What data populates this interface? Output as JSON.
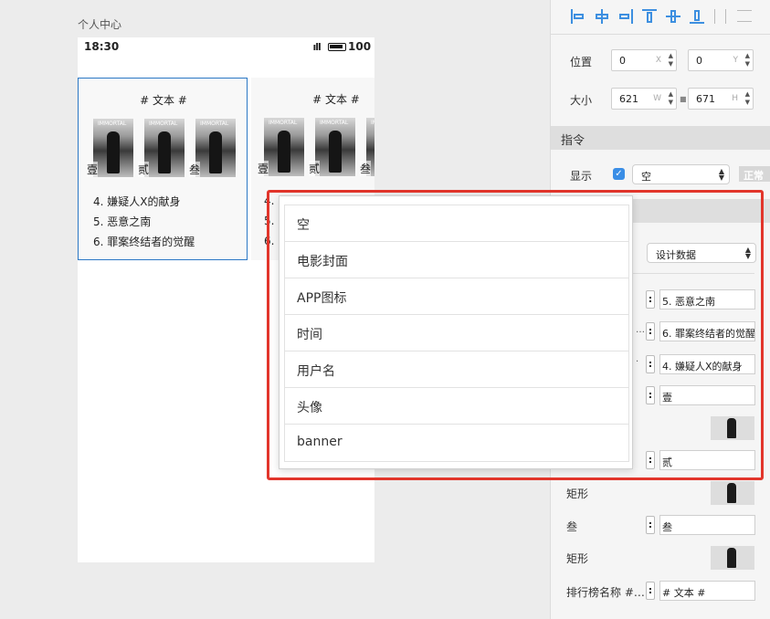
{
  "canvas": {
    "artboard_title": "个人中心",
    "status_bar": {
      "time": "18:30",
      "signal": " ıll",
      "battery": "100"
    },
    "cards": [
      {
        "title": "# 文本 #",
        "poster_header": "IMMORTAL",
        "poster_labels": [
          "壹",
          "贰",
          "叁"
        ],
        "items": [
          "4. 嫌疑人X的献身",
          "5. 恶意之南",
          "6. 罪案终结者的觉醒"
        ]
      },
      {
        "title": "# 文本 #",
        "poster_header": "IMMORTAL",
        "poster_labels": [
          "壹",
          "贰",
          "叁"
        ],
        "items": [
          "4.",
          "5.",
          "6."
        ]
      }
    ]
  },
  "inspector": {
    "position_label": "位置",
    "x_value": "0",
    "x_unit": "X",
    "y_value": "0",
    "y_unit": "Y",
    "size_label": "大小",
    "w_value": "621",
    "w_unit": "W",
    "h_value": "671",
    "h_unit": "H",
    "directive_header": "指令",
    "show_label": "显示",
    "show_checked": true,
    "show_select_value": "空",
    "normal_badge": "正常",
    "design_data_select": "设计数据",
    "rows": [
      {
        "label": "",
        "value": "5. 恶意之南"
      },
      {
        "label": "",
        "value": "6. 罪案终结者的觉醒"
      },
      {
        "label": "",
        "value": "4. 嫌疑人X的献身"
      },
      {
        "label": "",
        "value": "壹"
      },
      {
        "label": "",
        "value": "贰"
      },
      {
        "label": "叁",
        "value": "叁"
      },
      {
        "label": "排行榜名称 #…",
        "value": "# 文本 #"
      }
    ],
    "rect_labels": [
      "矩形",
      "矩形"
    ]
  },
  "dropdown": {
    "options": [
      "空",
      "电影封面",
      "APP图标",
      "时间",
      "用户名",
      "头像",
      "banner"
    ]
  },
  "colors": {
    "accent": "#3d8fe0",
    "highlight": "#e2352b",
    "selection": "#2b78c5"
  }
}
